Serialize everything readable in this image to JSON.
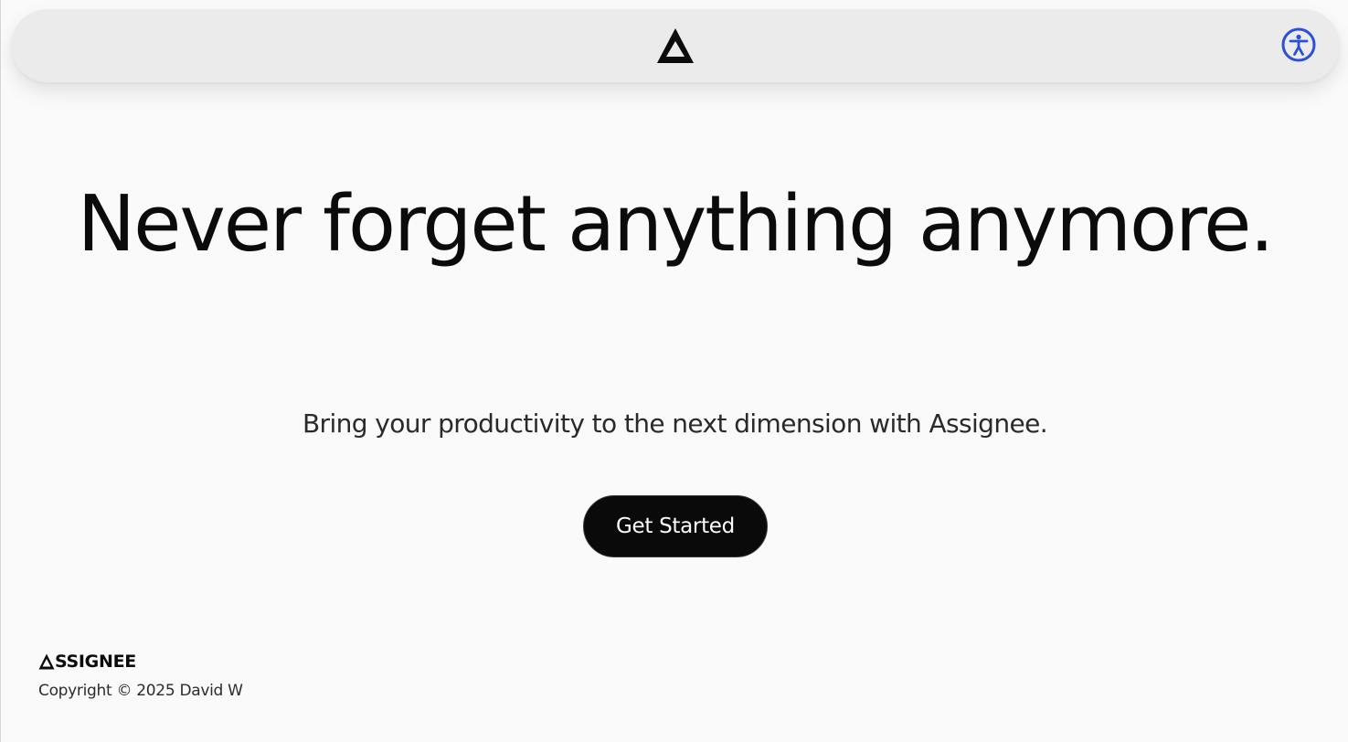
{
  "navbar": {
    "logo_icon": "delta-triangle-logo-icon",
    "accessibility_icon": "accessibility-person-icon",
    "accessibility_color": "#2b4fd8"
  },
  "hero": {
    "title": "Never forget anything anymore.",
    "subtitle": "Bring your productivity to the next dimension with Assignee.",
    "cta_label": "Get Started"
  },
  "footer": {
    "brand_logo": "ASSIGNEE",
    "brand_text": "SSIGNEE",
    "copyright": "Copyright © 2025 David W"
  },
  "colors": {
    "background": "#fafafa",
    "navbar": "#ebebeb",
    "text": "#0b0b0b",
    "cta_background": "#0a0a0a",
    "cta_text": "#ffffff"
  }
}
